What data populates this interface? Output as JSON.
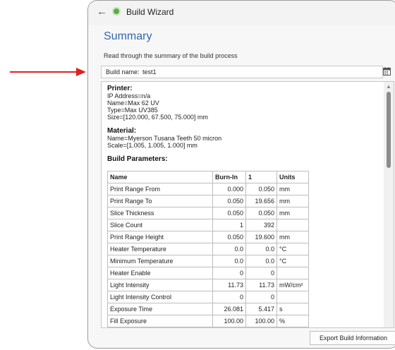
{
  "window": {
    "title": "Build Wizard"
  },
  "page": {
    "heading": "Summary",
    "description": "Read through the summary of the build process"
  },
  "build_name": {
    "label": "Build name:",
    "value": "test1"
  },
  "printer": {
    "title": "Printer:",
    "lines": [
      "IP Address=n/a",
      "Name=Max 62 UV",
      "Type=Max UV385",
      "Size=[120.000, 67.500, 75.000] mm"
    ]
  },
  "material": {
    "title": "Material:",
    "lines": [
      "Name=Myerson Tusana Teeth 50 micron",
      "Scale=[1.005, 1.005, 1.000] mm"
    ]
  },
  "build_parameters": {
    "title": "Build Parameters:",
    "headers": [
      "Name",
      "Burn-In",
      "1",
      "Units"
    ],
    "rows": [
      [
        "Print Range From",
        "0.000",
        "0.050",
        "mm"
      ],
      [
        "Print Range To",
        "0.050",
        "19.656",
        "mm"
      ],
      [
        "Slice Thickness",
        "0.050",
        "0.050",
        "mm"
      ],
      [
        "Slice Count",
        "1",
        "392",
        ""
      ],
      [
        "Print Range Height",
        "0.050",
        "19.600",
        "mm"
      ],
      [
        "Heater Temperature",
        "0.0",
        "0.0",
        "°C"
      ],
      [
        "Minimum Temperature",
        "0.0",
        "0.0",
        "°C"
      ],
      [
        "Heater Enable",
        "0",
        "0",
        ""
      ],
      [
        "Light Intensity",
        "11.73",
        "11.73",
        "mW/cm²"
      ],
      [
        "Light Intensity Control",
        "0",
        "0",
        ""
      ],
      [
        "Exposure Time",
        "26.081",
        "5.417",
        "s"
      ],
      [
        "Fill Exposure",
        "100.00",
        "100.00",
        "%"
      ]
    ]
  },
  "buttons": {
    "export": "Export Build Information"
  },
  "colors": {
    "accent": "#2f66b3",
    "arrow": "#e02020",
    "app_icon": "#5aa94a"
  },
  "icons": [
    "back-arrow-icon",
    "app-icon",
    "calendar-icon"
  ]
}
